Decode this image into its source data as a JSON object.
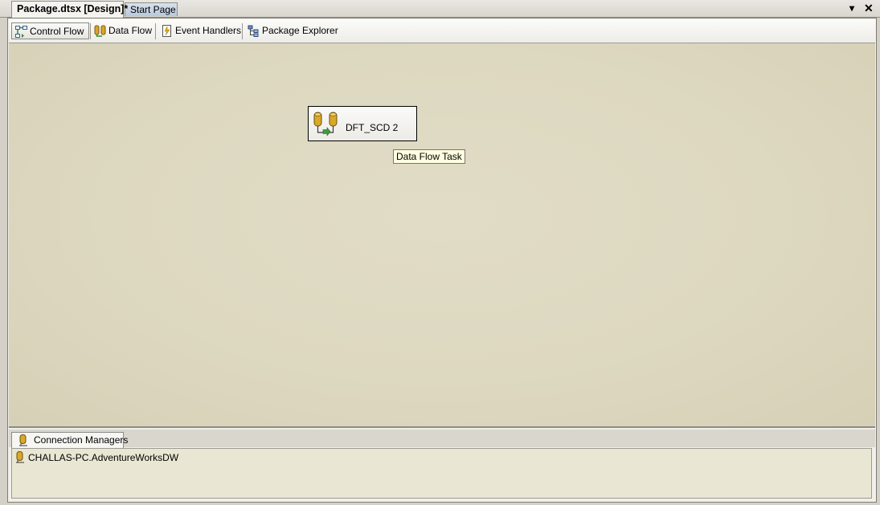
{
  "document_tabs": [
    {
      "label": "Package.dtsx [Design]*",
      "active": true
    },
    {
      "label": "Start Page",
      "active": false
    }
  ],
  "window_controls": {
    "dropdown": "▾",
    "close": "✕"
  },
  "designer_tabs": [
    {
      "label": "Control Flow",
      "icon": "control-flow-icon",
      "selected": true
    },
    {
      "label": "Data Flow",
      "icon": "data-flow-icon",
      "selected": false
    },
    {
      "label": "Event Handlers",
      "icon": "event-handlers-icon",
      "selected": false
    },
    {
      "label": "Package Explorer",
      "icon": "package-explorer-icon",
      "selected": false
    }
  ],
  "canvas": {
    "task": {
      "label": "DFT_SCD 2",
      "icon": "data-flow-task-icon"
    },
    "tooltip": "Data Flow Task"
  },
  "connection_managers": {
    "tab_label": "Connection Managers",
    "items": [
      {
        "label": "CHALLAS-PC.AdventureWorksDW",
        "icon": "connection-manager-icon"
      }
    ]
  },
  "colors": {
    "canvas": "#ddd8c0",
    "tooltip": "#ffffe1",
    "panel": "#e9e6d3"
  }
}
